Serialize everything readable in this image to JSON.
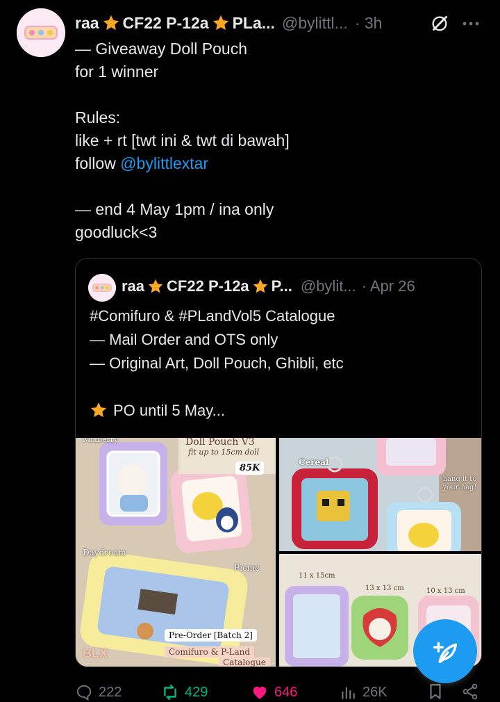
{
  "tweet": {
    "display_name": "raa",
    "name_part2": "CF22 P-12a",
    "name_part3": "PLa...",
    "handle": "@bylittl...",
    "time": "· 3h",
    "text_lines": [
      "— Giveaway Doll Pouch",
      "for 1 winner",
      "",
      "Rules:",
      "like + rt [twt ini & twt di bawah]"
    ],
    "follow_prefix": "follow ",
    "follow_mention": "@bylittlextar",
    "text_lines_after": [
      "",
      "— end 4 May 1pm / ina only",
      "goodluck<3"
    ]
  },
  "quote": {
    "display_name": "raa",
    "name_part2": "CF22 P-12a",
    "name_part3": "P...",
    "handle": "@bylit...",
    "date": "· Apr 26",
    "text_lines": [
      "#Comifuro & #PLandVol5 Catalogue",
      "— Mail Order and OTS only",
      "— Original Art, Doll Pouch, Ghibli, etc",
      ""
    ],
    "last_line": "PO until 5 May...",
    "media": {
      "img1": {
        "title": "Doll Pouch V3",
        "subtitle": "fit up to 15cm doll",
        "price": "85K",
        "corner": "Mixberry",
        "label_daydream": "Daydream",
        "label_picnic": "Picnic",
        "badge": "Pre-Order [Batch 2]",
        "footer": "Comifuro & P-Land",
        "footer2": "Catalogue",
        "logo": "BLX"
      },
      "img2": {
        "label_cereal": "Cereal",
        "note": "hang it to your bag!"
      },
      "img3": {
        "size1": "11 x 15cm",
        "size2": "13 x 13 cm",
        "size3": "10 x 13 cm"
      }
    }
  },
  "actions": {
    "replies": "222",
    "reposts": "429",
    "likes": "646",
    "views": "26K"
  },
  "colors": {
    "background": "#000000",
    "text": "#e7e9ea",
    "secondary": "#71767b",
    "link": "#1d9bf0",
    "repost": "#00ba7c",
    "like": "#f91880",
    "fab": "#1d9bf0"
  }
}
